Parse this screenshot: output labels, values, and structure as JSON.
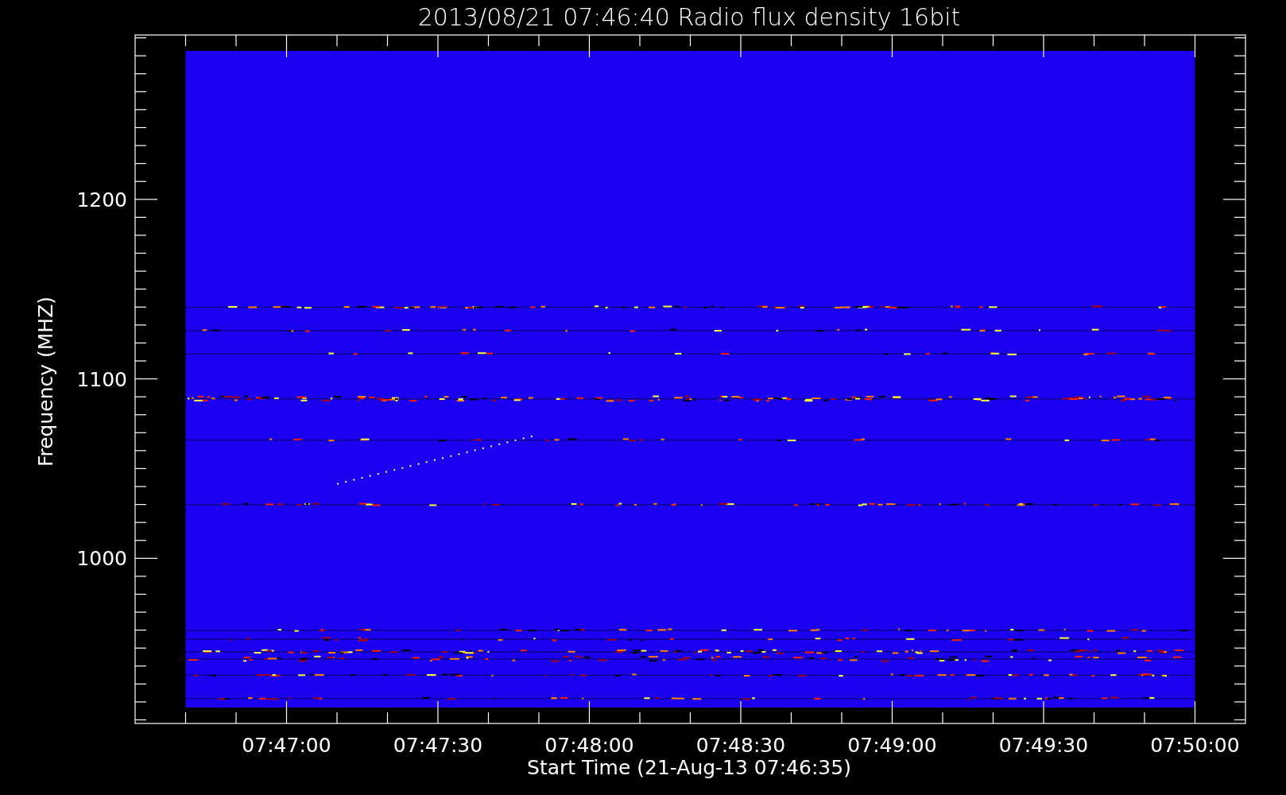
{
  "title": "2013/08/21 07:46:40 Radio flux density 16bit",
  "y_axis": {
    "label": "Frequency (MHZ)",
    "ticks": [
      "1200",
      "1100",
      "1000"
    ]
  },
  "x_axis": {
    "label": "Start Time (21-Aug-13 07:46:35)",
    "ticks": [
      "07:47:00",
      "07:47:30",
      "07:48:00",
      "07:48:30",
      "07:49:00",
      "07:49:30",
      "07:50:00"
    ]
  }
}
